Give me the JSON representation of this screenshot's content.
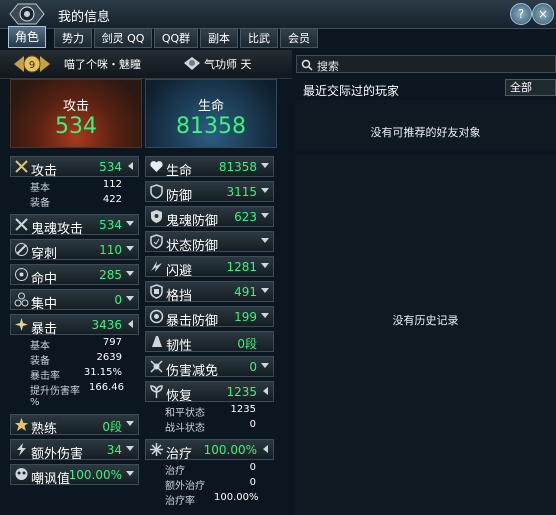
{
  "window": {
    "title": "我的信息"
  },
  "tabs": [
    {
      "label": "角色",
      "active": true
    },
    {
      "label": "势力"
    },
    {
      "label": "剑灵 QQ"
    },
    {
      "label": "QQ群"
    },
    {
      "label": "副本"
    },
    {
      "label": "比武"
    },
    {
      "label": "会员"
    }
  ],
  "titles": {
    "title1": "喵了个咪・魅瞳",
    "title2": "气功师",
    "title2_suffix": "天"
  },
  "big": {
    "attack": {
      "label": "攻击",
      "value": "534"
    },
    "life": {
      "label": "生命",
      "value": "81358"
    }
  },
  "left_stats": [
    {
      "label": "攻击",
      "value": "534",
      "icon": "crossed-swords-icon",
      "arrow": "left"
    },
    {
      "label": "鬼魂攻击",
      "value": "534",
      "icon": "ghost-attack-icon",
      "arrow": "down"
    },
    {
      "label": "穿刺",
      "value": "110",
      "icon": "pierce-icon",
      "arrow": "down"
    },
    {
      "label": "命中",
      "value": "285",
      "icon": "target-icon",
      "arrow": "down"
    },
    {
      "label": "集中",
      "value": "0",
      "icon": "focus-icon",
      "arrow": "down"
    },
    {
      "label": "暴击",
      "value": "3436",
      "icon": "critical-icon",
      "arrow": "left"
    },
    {
      "label": "熟练",
      "value": "0段",
      "icon": "mastery-icon",
      "arrow": "down"
    },
    {
      "label": "额外伤害",
      "value": "34",
      "icon": "extra-damage-icon",
      "arrow": "down"
    },
    {
      "label": "嘲讽值",
      "value": "100.00%",
      "icon": "taunt-icon",
      "arrow": "down"
    }
  ],
  "attack_sub": [
    {
      "label": "基本",
      "value": "112"
    },
    {
      "label": "装备",
      "value": "422"
    }
  ],
  "crit_sub": [
    {
      "label": "基本",
      "value": "797"
    },
    {
      "label": "装备",
      "value": "2639"
    },
    {
      "label": "暴击率",
      "value": "31.15%"
    },
    {
      "label": "提升伤害率",
      "value": "166.46"
    },
    {
      "label": "%",
      "value": ""
    }
  ],
  "right_stats": [
    {
      "label": "生命",
      "value": "81358",
      "icon": "heart-icon",
      "arrow": "down"
    },
    {
      "label": "防御",
      "value": "3115",
      "icon": "shield-icon",
      "arrow": "down"
    },
    {
      "label": "鬼魂防御",
      "value": "623",
      "icon": "ghost-shield-icon",
      "arrow": "down"
    },
    {
      "label": "状态防御",
      "value": "",
      "icon": "status-shield-icon",
      "arrow": "down"
    },
    {
      "label": "闪避",
      "value": "1281",
      "icon": "evade-icon",
      "arrow": "down"
    },
    {
      "label": "格挡",
      "value": "491",
      "icon": "block-icon",
      "arrow": "down"
    },
    {
      "label": "暴击防御",
      "value": "199",
      "icon": "crit-defense-icon",
      "arrow": "down"
    },
    {
      "label": "韧性",
      "value": "0段",
      "icon": "toughness-icon",
      "arrow": ""
    },
    {
      "label": "伤害减免",
      "value": "0",
      "icon": "damage-reduce-icon",
      "arrow": "down"
    },
    {
      "label": "恢复",
      "value": "1235",
      "icon": "recovery-icon",
      "arrow": "left"
    },
    {
      "label": "治疗",
      "value": "100.00%",
      "icon": "heal-icon",
      "arrow": "left"
    }
  ],
  "recovery_sub": [
    {
      "label": "和平状态",
      "value": "1235"
    },
    {
      "label": "战斗状态",
      "value": "0"
    }
  ],
  "heal_sub": [
    {
      "label": "治疗",
      "value": "0"
    },
    {
      "label": "额外治疗",
      "value": "0"
    },
    {
      "label": "治疗率",
      "value": "100.00%"
    }
  ],
  "right_panel": {
    "search_placeholder": "搜索",
    "recent_header": "最近交际过的玩家",
    "filter_value": "全部",
    "no_friends": "没有可推荐的好友对象",
    "no_history": "没有历史记录"
  },
  "colors": {
    "stat_value": "#3ef27a",
    "accent": "#a9c7dc"
  }
}
